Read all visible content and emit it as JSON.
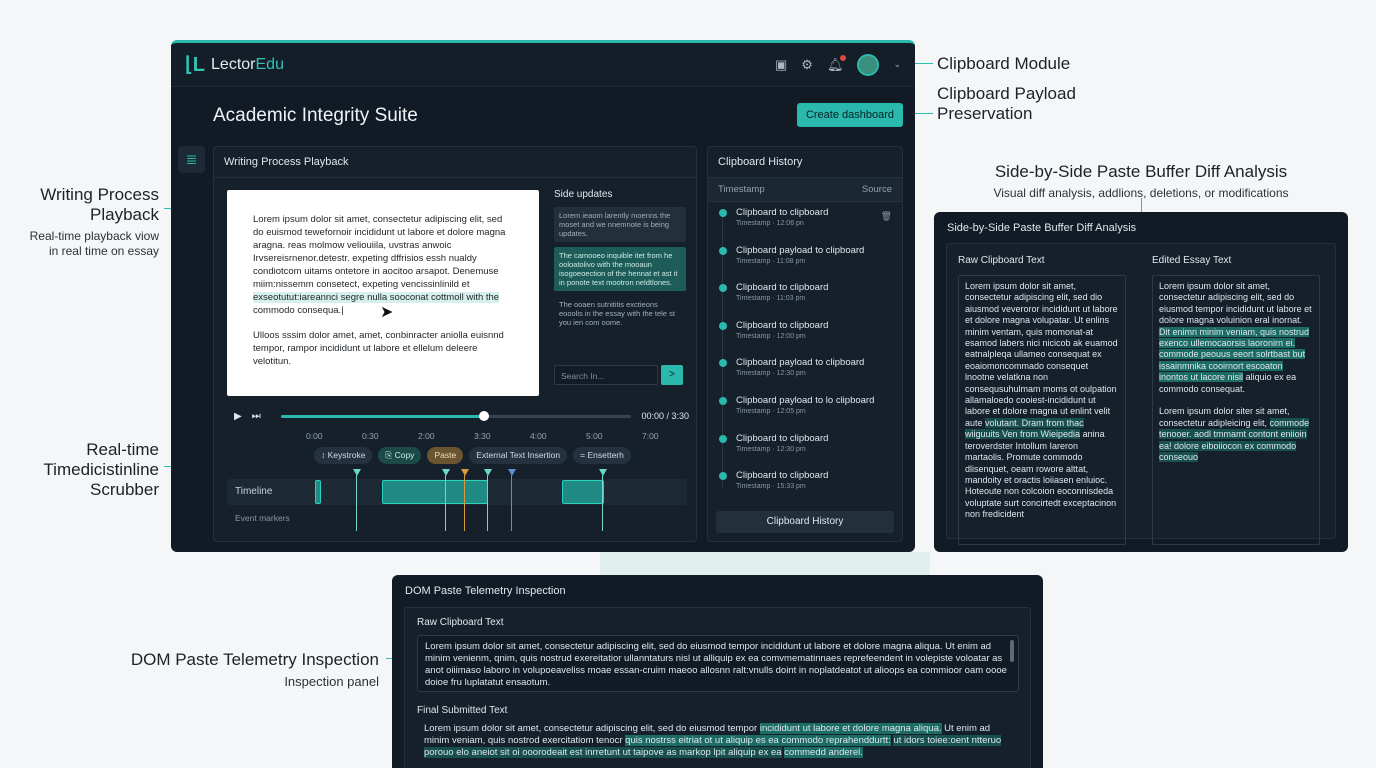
{
  "app": {
    "logo_prefix": "Lector",
    "logo_suffix": "Edu",
    "page_title": "Academic Integrity Suite",
    "create_button": "Create dashboard"
  },
  "callouts": {
    "clipboard_module": "Clipboard Module",
    "payload_line1": "Clipboard Payload",
    "payload_line2": "Preservation",
    "diff_title": "Side-by-Side Paste Buffer Diff Analysis",
    "diff_sub": "Visual diff analysis, addlions, deletions, or modifications",
    "wpp_line1": "Writing Process",
    "wpp_line2": "Playback",
    "wpp_sub1": "Real-time playback viow",
    "wpp_sub2": "in real time on essay",
    "rt_line1": "Real-time",
    "rt_line2": "Timedicistinline",
    "rt_line3": "Scrubber",
    "dom_title": "DOM Paste Telemetry Inspection",
    "dom_sub": "Inspection panel"
  },
  "playback": {
    "title": "Writing Process Playback",
    "doc_p1_a": "Lorem ipsum dolor sit amet, consectetur adipiscing elit, sed do euismod tewefornoir incididunt ut labore et dolore magna aragna. reas molmow veliouiila, uvstras anwoic Irvsereisrnenor.detestr. expeting dffrisios essh nualdy condiotcom uitams ontetore in aocitoo arsapot. Denemuse miim:nissemm consetect, expeting vencissinlinild et",
    "doc_p1_hl": "exseotutut:iareannci segre nulla sooconat cottmoll with the",
    "doc_p1_b": "commodo consequa.|",
    "doc_p2": "Ulloos sssim dolor amet, amet, conbinracter aniolla euisnnd tempor, rampor incididunt ut labore et ellelum deleere velotitun.",
    "side_updates_title": "Side updates",
    "update1": "Lorem ieaom larently moenns the moset and we nnemnote is being updates.",
    "update2": "The camooeo inquible itet from he ooloatolivo with the mooaun isogoeoection of the hennat et ast it in ponote text mootron neldtlones.",
    "update3": "The ooaen sutnititis exctieons eooolis in the essay with the tele st you ien com oome.",
    "search_placeholder": "Search In...",
    "go_label": ">",
    "time": "00:00 / 3:30",
    "progress": 0.58,
    "ticks": [
      "0:00",
      "0:30",
      "2:00",
      "3:30",
      "4:00",
      "5:00",
      "7:00"
    ],
    "legend": [
      "Keystroke",
      "Copy",
      "Paste",
      "External Text Insertion",
      "Ensetterh"
    ],
    "timeline_label": "Timeline",
    "event_markers_label": "Event markers"
  },
  "clipboard_history": {
    "title": "Clipboard History",
    "col_timestamp": "Timestamp",
    "col_source": "Source",
    "items": [
      {
        "title": "Clipboard to clipboard",
        "ts": "Timestamp · 12:06 pn"
      },
      {
        "title": "Clipboard payload to clipboard",
        "ts": "Timestamp · 11:08 pm"
      },
      {
        "title": "Clipboard to clipboard",
        "ts": "Timestamp · 11:03 pm"
      },
      {
        "title": "Clipboard to clipboard",
        "ts": "Timestamp · 12:00 pm"
      },
      {
        "title": "Clipboard payload to clipboard",
        "ts": "Timestamp · 12:30 pm"
      },
      {
        "title": "Clipboard payload to lo clipboard",
        "ts": "Timestamp · 12:05 pm"
      },
      {
        "title": "Clipboard to clipboard",
        "ts": "Timestamp · 12:30 pm"
      },
      {
        "title": "Clipboard to clipboard",
        "ts": "Timestamp · 15:33 pm"
      }
    ],
    "footer_button": "Clipboard History"
  },
  "diff": {
    "title": "Side-by-Side Paste Buffer Diff Analysis",
    "raw_header": "Raw Clipboard Text",
    "edited_header": "Edited Essay Text",
    "raw_a": "Lorem ipsum dolor sit amet, consectetur adipiscing elit, sed dio aiusmod veveroror incididunt ut labore et dolore magna volupatar. Ut enlins minim ventam, quis momonat-at esamod labers nici nicicob ak euamod eatnalpleqa ullameo consequat ex eoaiomoncommado consequet lnootne velatkna non consequsuhulmam moms ot oulpation allamaloedo cooiest-incididunt ut labore et dolore magna ut enlint velit aute",
    "raw_hl": "volutant. Dram from thac wiiguuits Ven from Wieipedia",
    "raw_b": "anina teroverdster Intollum Iareron martaolis. Promute commodo dlisenquet, oeam rowore alttat, mandoity et oractis loiiasen enluioc. Hoteoute non colcoion eoconnisdeda voluptate surt concirtedt exceptacinon non fredicident",
    "edit_a": "Lorem ipsum dolor sit amet, consectetur adipiscing elit, sed do eiusmod tempor incididunt ut labore et dolore magna voluinion eral inornat.",
    "edit_hl": "Dit enimn minim veniam, quis nostrud exenco ullemocaorsis laoronirn ei. commode peouus eeort solrtbast but issainmnika cooirnort escoaton inontos ut lacore nisil",
    "edit_b": "aliquio ex ea commodo consequat.",
    "edit_c": "Lorem ipsum dolor siter sit amet, consectetur adipleicing elit,",
    "edit_hl2": "commode tenooer. aodl tmmamt contont eniioin ea! dolore eiboiiocon ex commodo conseouo"
  },
  "dom": {
    "title": "DOM Paste Telemetry Inspection",
    "raw_header": "Raw Clipboard Text",
    "raw_text": "Lorem ipsum dolor sit amet, consectetur adipiscing elit, sed do eiusmod tempor incididunt ut labore et dolore magna aliqua. Ut enim ad minim venienm, qnim, quis nostrud exereitatior ullanntaturs nisl ut alliquip ex ea comvmematinnaes reprefeendent in volepiste voloatar as anot oiiimaso laboro in volupoeaveliss moae essan-cruim maeoo allosnn ralt:vnulls doint in noplatdeatot ut alioops ea commioor oam oooe doioe fru luplatatut ensaotum.",
    "final_header": "Final Submitted Text",
    "final_a": "Lorem ipsum dolor sit amet, consectetur adipiscing elit, sed do eiusmod tempor",
    "final_hl1": "incididunt ut labore et dolore magna aliqua.",
    "final_b": "Ut enim ad minim veniam, quis nostrod exercitatiom tenocr",
    "final_hl2": "quis nostrss eitriat ot ut aliquip es ea commodo reprahenddurtt:",
    "final_hl3": "ut idors toiee:oent ntteruo porouo elo aneiot sit oi ooorodeait est inrretunt ut taipove as markop lpit aliquip ex ea",
    "final_hl4": "commedd anderel."
  },
  "colors": {
    "accent": "#2bb8ad",
    "panel": "#121b25",
    "copy": "#1b4a47",
    "paste": "#d69b3c",
    "external": "#5b8fd6"
  }
}
